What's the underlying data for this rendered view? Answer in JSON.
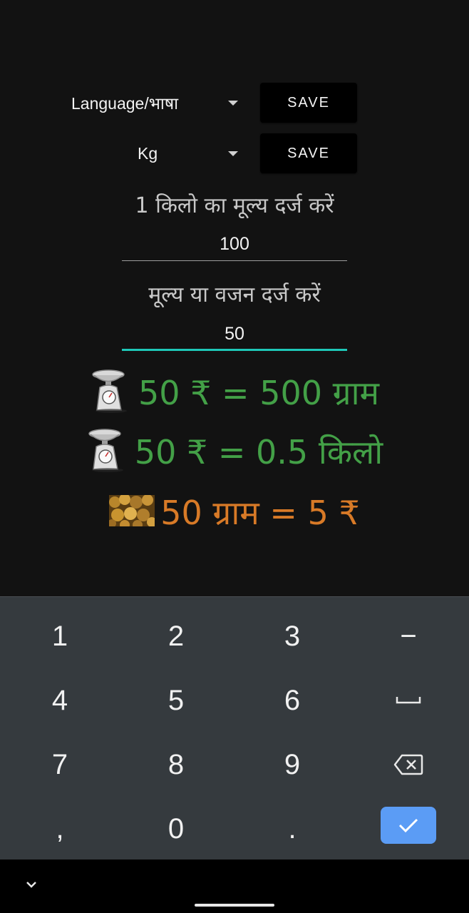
{
  "settings": {
    "language_label": "Language/भाषा",
    "unit_label": "Kg",
    "save_label": "SAVE"
  },
  "form": {
    "price_label": "1 किलो का मूल्य दर्ज करें",
    "price_value": "100",
    "amount_label": "मूल्य या वजन दर्ज करें",
    "amount_value": "50"
  },
  "results": {
    "grams": "50 ₹ = 500 ग्राम",
    "kilos": "50 ₹ = 0.5 किलो",
    "price": "50 ग्राम = 5 ₹"
  },
  "colors": {
    "weight_result": "#43a047",
    "price_result": "#d87a27",
    "focus_accent": "#1ec8b8",
    "enter_key": "#5b9cf5"
  },
  "keyboard": {
    "k1": "1",
    "k2": "2",
    "k3": "3",
    "kminus": "−",
    "k4": "4",
    "k5": "5",
    "k6": "6",
    "k7": "7",
    "k8": "8",
    "k9": "9",
    "kcomma": ",",
    "k0": "0",
    "kdot": ".",
    "space_icon": "space-icon",
    "backspace_icon": "backspace-icon",
    "enter_icon": "checkmark-icon"
  },
  "nav": {
    "hide_keyboard_icon": "chevron-down-icon"
  }
}
